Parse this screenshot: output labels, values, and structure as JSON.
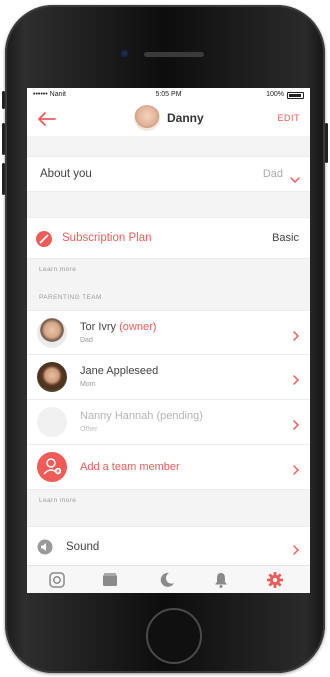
{
  "status_bar": {
    "carrier": "•••••• Nanit",
    "time": "5:05 PM",
    "battery": "100%"
  },
  "header": {
    "title": "Danny",
    "edit_label": "EDIT"
  },
  "about": {
    "label": "About you",
    "value": "Dad"
  },
  "subscription": {
    "label": "Subscription Plan",
    "value": "Basic",
    "learn_more": "Learn more"
  },
  "parenting_team": {
    "caption": "PARENTING TEAM",
    "members": [
      {
        "name": "Tor Ivry",
        "tag": "(owner)",
        "role": "Dad"
      },
      {
        "name": "Jane Appleseed",
        "tag": "",
        "role": "Mom"
      },
      {
        "name": "Nanny Hannah (pending)",
        "tag": "",
        "role": "Other"
      }
    ],
    "add_label": "Add a team member",
    "learn_more": "Learn more"
  },
  "sound": {
    "label": "Sound"
  },
  "tabbar": {
    "icons": [
      "camera-icon",
      "archive-icon",
      "moon-icon",
      "bell-icon",
      "gear-icon"
    ],
    "active": "gear-icon",
    "accent": "#ef5b57"
  },
  "colors": {
    "accent": "#ef5b57",
    "background": "#f4f4f4"
  }
}
